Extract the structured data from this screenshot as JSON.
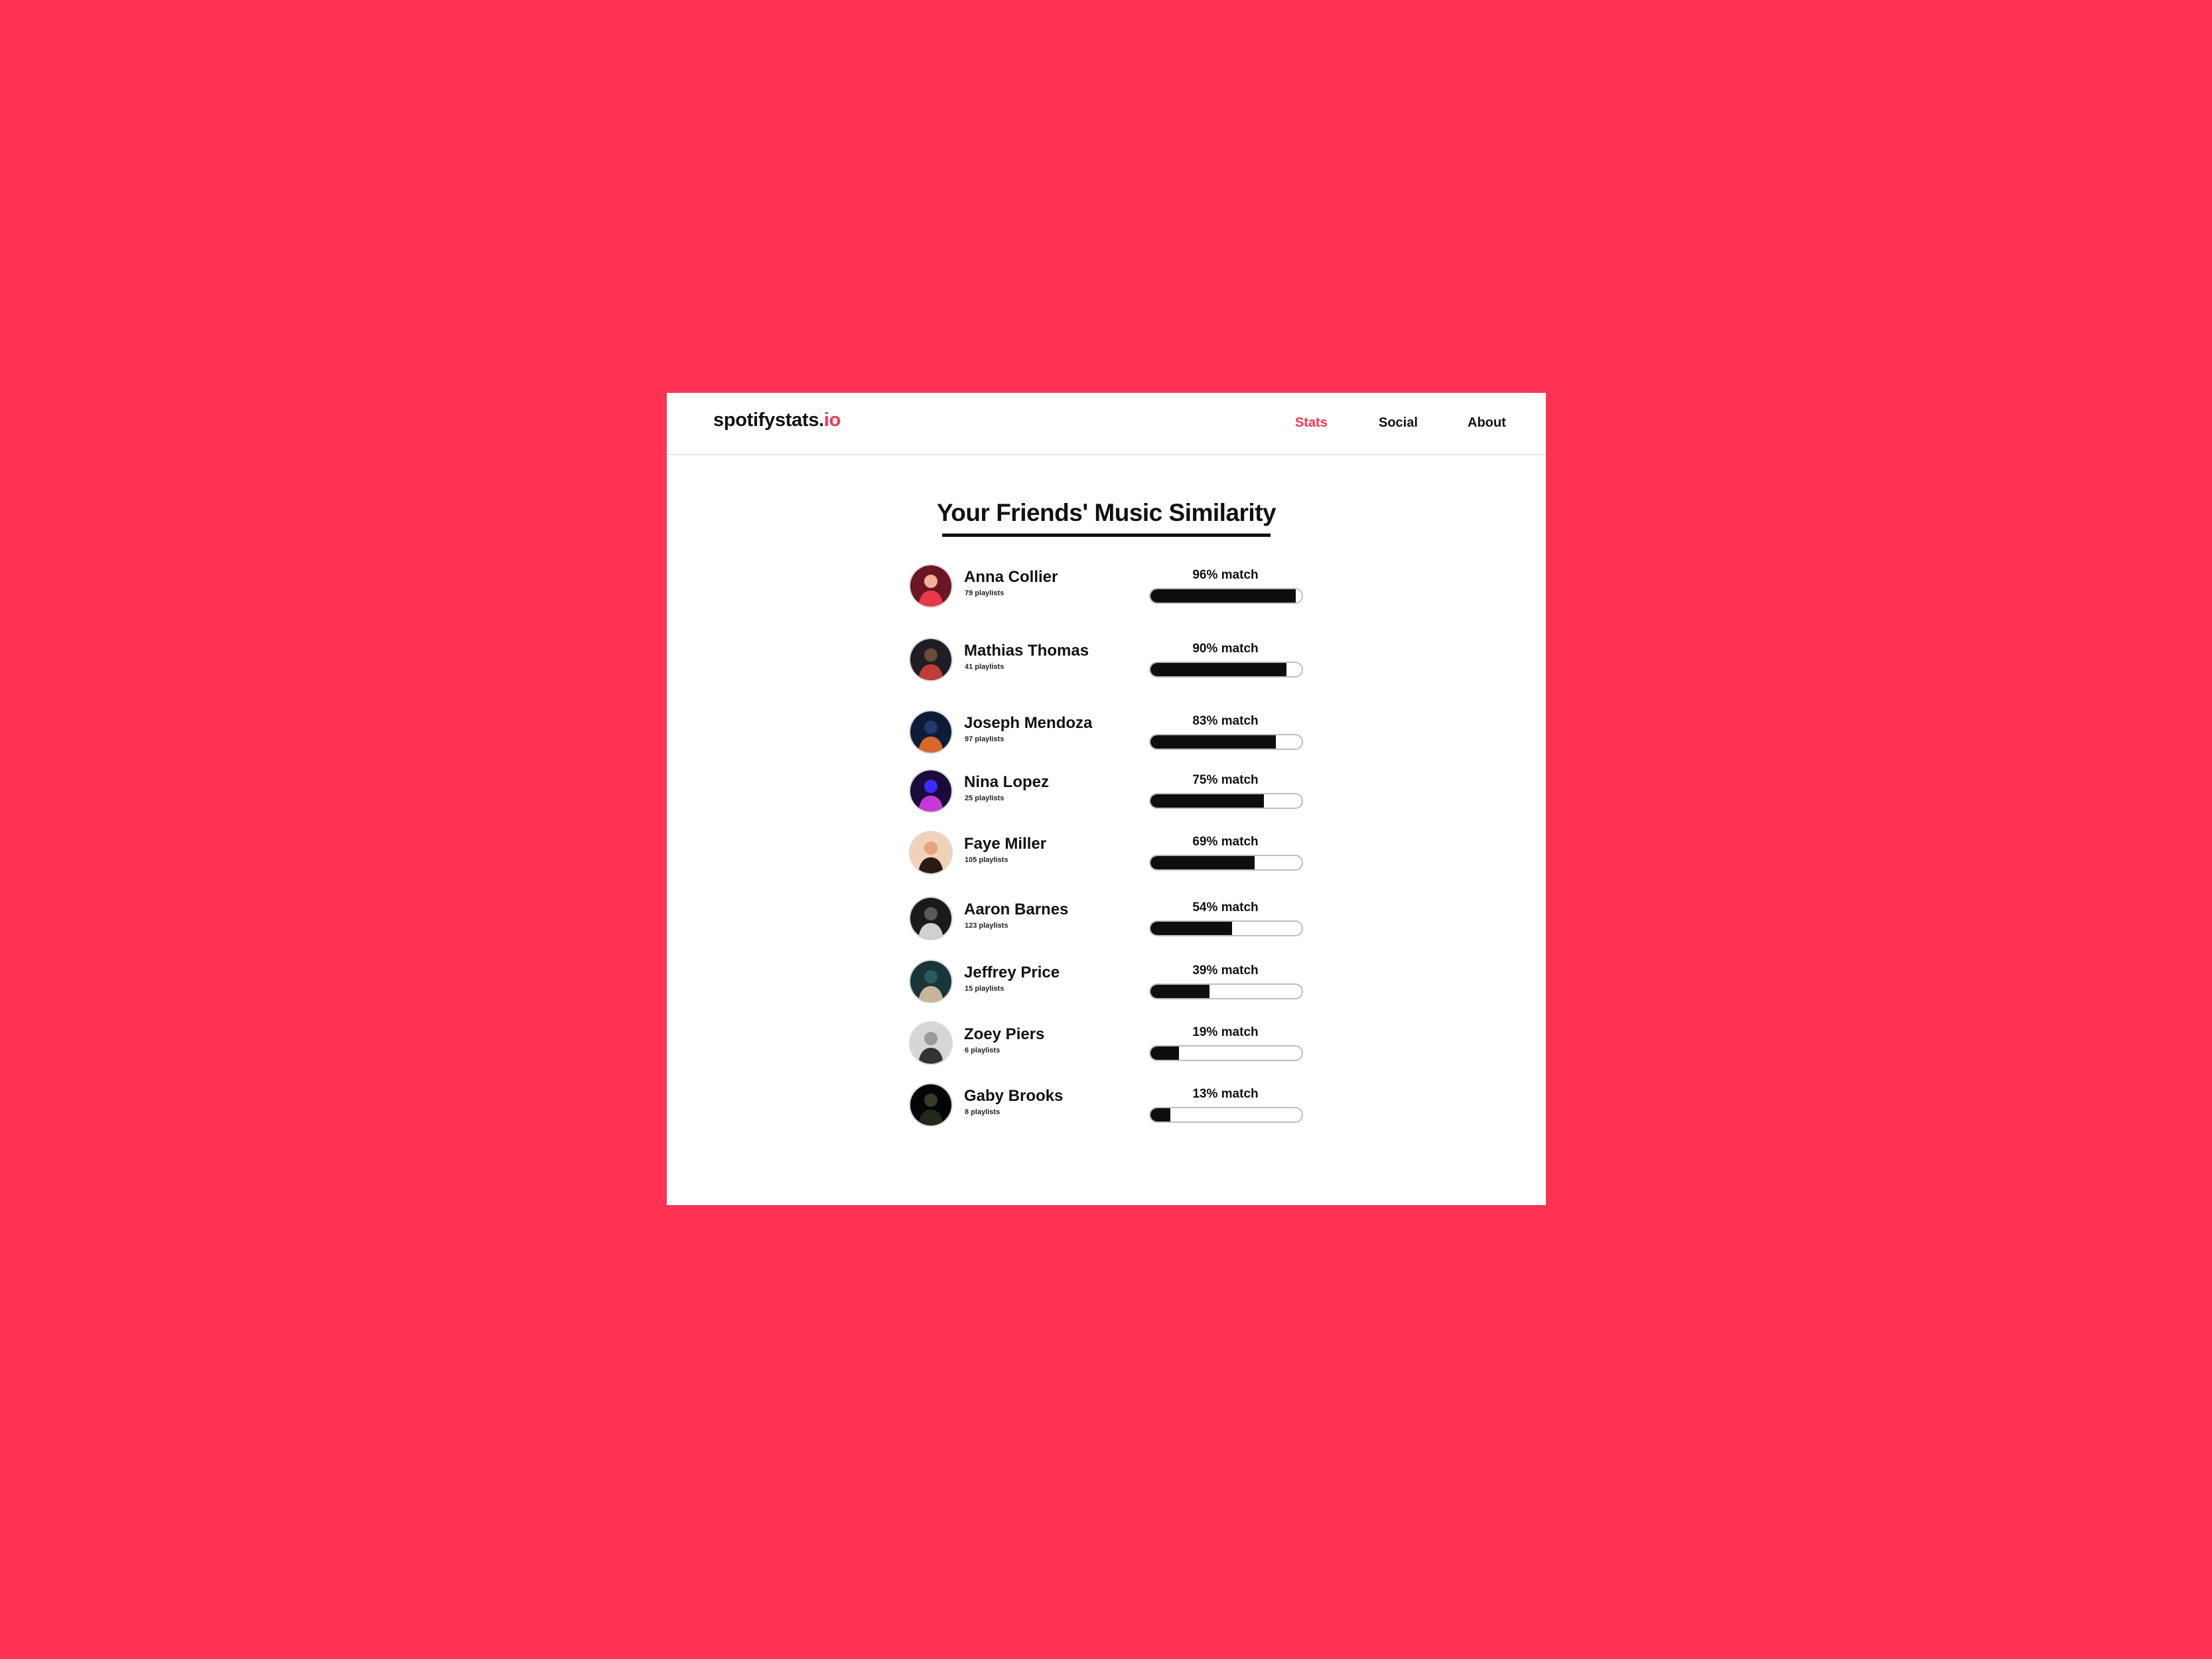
{
  "colors": {
    "background": "#FF3254",
    "accent": "#FF3254",
    "text": "#111111",
    "bar_fill": "#0e0e0e"
  },
  "header": {
    "logo_main": "spotifystats.",
    "logo_tld": "io",
    "nav": [
      {
        "label": "Stats",
        "active": true
      },
      {
        "label": "Social",
        "active": false
      },
      {
        "label": "About",
        "active": false
      }
    ]
  },
  "main": {
    "title": "Your Friends' Music Similarity",
    "friends": [
      {
        "name": "Anna Collier",
        "playlists": "79 playlists",
        "match_label": "96% match",
        "match": 96,
        "avatar_icon": "person-photo-red"
      },
      {
        "name": "Mathias Thomas",
        "playlists": "41 playlists",
        "match_label": "90% match",
        "match": 90,
        "avatar_icon": "person-photo-dark"
      },
      {
        "name": "Joseph Mendoza",
        "playlists": "97 playlists",
        "match_label": "83% match",
        "match": 83,
        "avatar_icon": "person-photo-blue"
      },
      {
        "name": "Nina Lopez",
        "playlists": "25 playlists",
        "match_label": "75% match",
        "match": 75,
        "avatar_icon": "person-photo-purple"
      },
      {
        "name": "Faye Miller",
        "playlists": "105 playlists",
        "match_label": "69% match",
        "match": 69,
        "avatar_icon": "person-photo-peach"
      },
      {
        "name": "Aaron Barnes",
        "playlists": "123 playlists",
        "match_label": "54% match",
        "match": 54,
        "avatar_icon": "person-photo-bw"
      },
      {
        "name": "Jeffrey Price",
        "playlists": "15 playlists",
        "match_label": "39% match",
        "match": 39,
        "avatar_icon": "person-photo-teal"
      },
      {
        "name": "Zoey Piers",
        "playlists": "6 playlists",
        "match_label": "19% match",
        "match": 19,
        "avatar_icon": "person-photo-grey"
      },
      {
        "name": "Gaby Brooks",
        "playlists": "8 playlists",
        "match_label": "13% match",
        "match": 13,
        "avatar_icon": "person-photo-black"
      }
    ]
  }
}
